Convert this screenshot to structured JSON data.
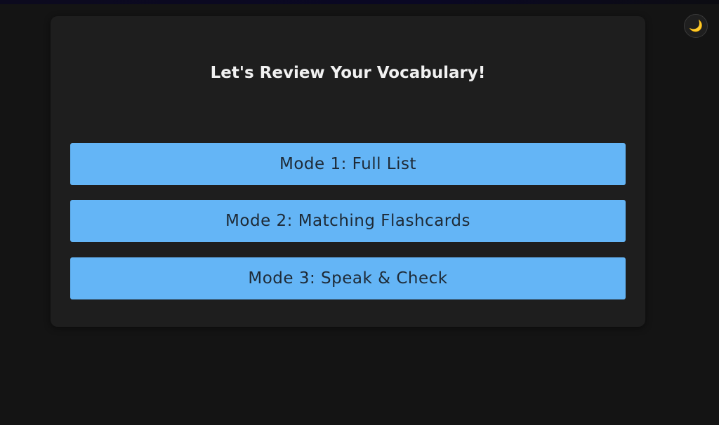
{
  "header": {
    "theme_toggle_icon": "moon-icon",
    "theme_toggle_glyph": "🌙"
  },
  "main": {
    "title": "Let's Review Your Vocabulary!",
    "modes": [
      {
        "label": "Mode 1: Full List"
      },
      {
        "label": "Mode 2: Matching Flashcards"
      },
      {
        "label": "Mode 3: Speak & Check"
      }
    ]
  },
  "colors": {
    "background": "#141414",
    "card": "#1e1e1e",
    "button": "#64b5f6",
    "button_text": "#1e2a36",
    "title_text": "#f1f1f1"
  }
}
